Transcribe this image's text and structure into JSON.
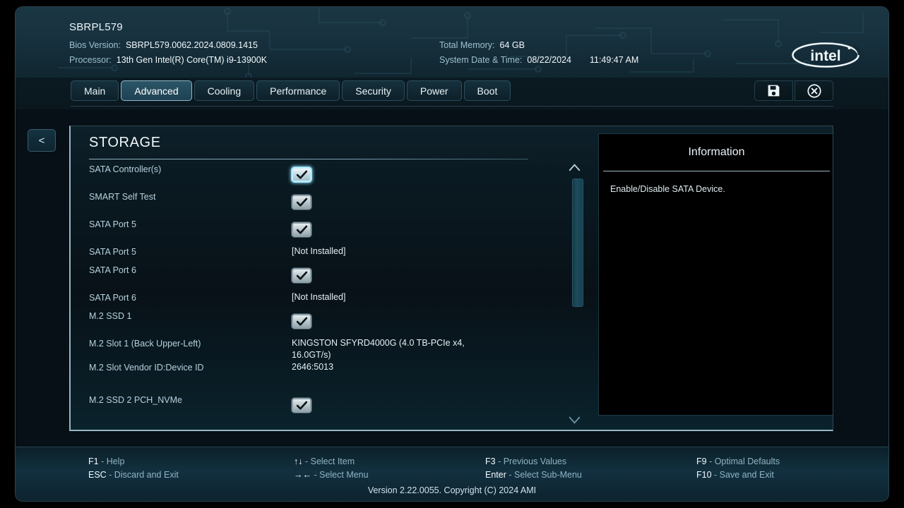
{
  "header": {
    "system_title": "SBRPL579",
    "left_rows": [
      {
        "label": "Bios Version:",
        "value": "SBRPL579.0062.2024.0809.1415"
      },
      {
        "label": "Processor:",
        "value": "13th Gen Intel(R) Core(TM) i9-13900K"
      }
    ],
    "right_rows": [
      {
        "label": "Total Memory:",
        "value": "64 GB",
        "value2": ""
      },
      {
        "label": "System Date & Time:",
        "value": "08/22/2024",
        "value2": "11:49:47 AM"
      }
    ],
    "logo_text": "intel",
    "logo_name": "intel-logo"
  },
  "tabs": [
    {
      "label": "Main",
      "active": false
    },
    {
      "label": "Advanced",
      "active": true
    },
    {
      "label": "Cooling",
      "active": false
    },
    {
      "label": "Performance",
      "active": false
    },
    {
      "label": "Security",
      "active": false
    },
    {
      "label": "Power",
      "active": false
    },
    {
      "label": "Boot",
      "active": false
    }
  ],
  "header_buttons": [
    {
      "name": "save-button",
      "icon": "floppy-disk-icon"
    },
    {
      "name": "exit-button",
      "icon": "close-circle-icon"
    }
  ],
  "back_button": {
    "label": "<"
  },
  "page": {
    "title": "STORAGE"
  },
  "settings": [
    {
      "label": "SATA Controller(s)",
      "type": "checkbox",
      "checked": true,
      "focused": true,
      "gap": 0
    },
    {
      "label": "SMART Self Test",
      "type": "checkbox",
      "checked": true,
      "focused": false,
      "gap": 0
    },
    {
      "label": "SATA Port 5",
      "type": "checkbox",
      "checked": true,
      "focused": false,
      "gap": 0
    },
    {
      "label": "SATA Port 5",
      "type": "text",
      "value": "[Not Installed]",
      "gap": 0
    },
    {
      "label": "SATA Port 6",
      "type": "checkbox",
      "checked": true,
      "focused": false,
      "gap": 0
    },
    {
      "label": "SATA Port 6",
      "type": "text",
      "value": "[Not Installed]",
      "gap": 0
    },
    {
      "label": "M.2 SSD 1",
      "type": "checkbox",
      "checked": true,
      "focused": false,
      "gap": 0
    },
    {
      "label": "M.2 Slot 1 (Back Upper-Left)",
      "type": "text",
      "value": "KINGSTON SFYRD4000G (4.0 TB-PCIe x4, 16.0GT/s)",
      "gap": 0
    },
    {
      "label": "M.2 Slot Vendor ID:Device ID",
      "type": "text",
      "value": "2646:5013",
      "gap": 0
    },
    {
      "label": "M.2 SSD 2 PCH_NVMe",
      "type": "checkbox",
      "checked": true,
      "focused": false,
      "gap": 20
    }
  ],
  "scrollbar": {
    "up_icon": "chevron-up-icon",
    "down_icon": "chevron-down-icon"
  },
  "information": {
    "title": "Information",
    "text": "Enable/Disable SATA Device."
  },
  "footer": {
    "columns": [
      [
        {
          "key": "F1",
          "desc": " - Help"
        },
        {
          "key": "ESC",
          "desc": " - Discard and Exit"
        }
      ],
      [
        {
          "key": "↑↓",
          "desc": " - Select Item"
        },
        {
          "key": "→←",
          "desc": " - Select Menu"
        }
      ],
      [
        {
          "key": "F3",
          "desc": " - Previous Values"
        },
        {
          "key": "Enter",
          "desc": " - Select Sub-Menu"
        }
      ],
      [
        {
          "key": "F9",
          "desc": " - Optimal Defaults"
        },
        {
          "key": "F10",
          "desc": " - Save and Exit"
        }
      ]
    ],
    "version": "Version 2.22.0055. Copyright (C) 2024 AMI"
  },
  "colors": {
    "accent": "#97b6c2",
    "panel_bg": "#081319",
    "header_bg": "#183240",
    "label": "#b6d2de",
    "value": "#e4eff4"
  }
}
